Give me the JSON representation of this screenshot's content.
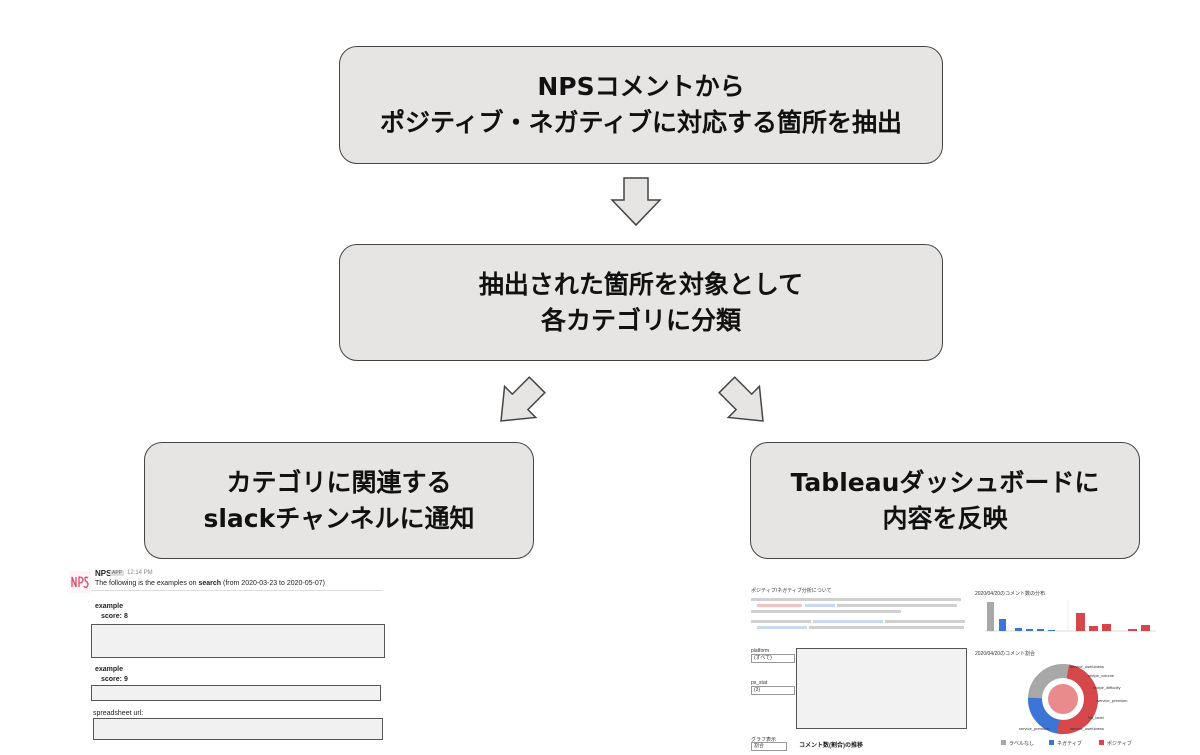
{
  "flow": {
    "step1": {
      "line1": "NPSコメントから",
      "line2": "ポジティブ・ネガティブに対応する箇所を抽出"
    },
    "step2": {
      "line1": "抽出された箇所を対象として",
      "line2": "各カテゴリに分類"
    },
    "slack_step": {
      "line1": "カテゴリに関連する",
      "line2": "slackチャンネルに通知"
    },
    "tableau_step": {
      "line1": "Tableauダッシュボードに",
      "line2": "内容を反映"
    }
  },
  "slack_preview": {
    "app_name": "NPS",
    "app_badge": "APP",
    "time": "12:14 PM",
    "message_prefix": "The following is the examples on ",
    "message_keyword": "search",
    "message_suffix": " (from 2020-03-23 to 2020-05-07)",
    "examples": [
      {
        "label": "example",
        "score": "score: 8"
      },
      {
        "label": "example",
        "score": "score: 9"
      }
    ],
    "spreadsheet_label": "spreadsheet url:"
  },
  "tableau_preview": {
    "heading": "ポジティブ/ネガティブ分析について",
    "filter1_label": "platform",
    "filter1_value": "(すべて)",
    "filter2_label": "ps_stat",
    "filter2_value": "(3)",
    "filter3_label": "グラフ表示",
    "filter3_value": "割合",
    "bar_title": "2020/04/20のコメント数の分布",
    "donut_title": "2020/04/20のコメント割合",
    "trend_title": "コメント数(割合)の推移",
    "donut_labels": [
      "service_usefulness",
      "recipe_volume",
      "recipe_difficulty",
      "service_premium",
      "No_label",
      "service_usefulness",
      "service_premium"
    ],
    "legend": [
      "ラベルなし",
      "ネガティブ",
      "ポジティブ"
    ],
    "colors": {
      "none": "#a8a8a8",
      "negative": "#3b76d6",
      "positive": "#d6474b"
    }
  }
}
